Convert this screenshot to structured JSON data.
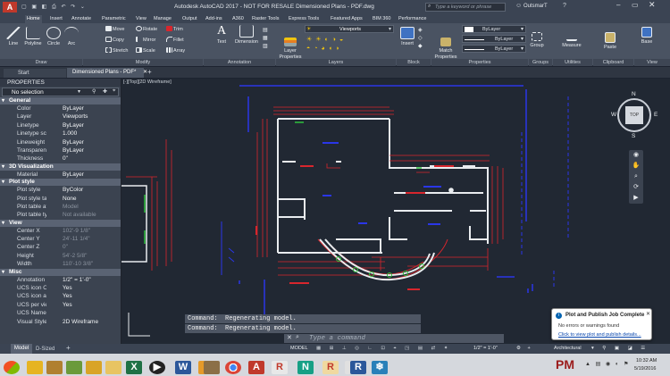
{
  "title_bar": {
    "title": "Autodesk AutoCAD 2017 - NOT FOR RESALE    Dimensioned Plans - PDF.dwg",
    "search_placeholder": "Type a keyword or phrase",
    "user": "OutsmarT"
  },
  "ribbon_tabs": [
    "Home",
    "Insert",
    "Annotate",
    "Parametric",
    "View",
    "Manage",
    "Output",
    "Add-ins",
    "A360",
    "Raster Tools",
    "Express Tools",
    "Featured Apps",
    "BIM 360",
    "Performance"
  ],
  "ribbon": {
    "draw": {
      "line": "Line",
      "polyline": "Polyline",
      "circle": "Circle",
      "arc": "Arc",
      "label": "Draw"
    },
    "modify": {
      "move": "Move",
      "rotate": "Rotate",
      "trim": "Trim",
      "copy": "Copy",
      "mirror": "Mirror",
      "fillet": "Fillet",
      "stretch": "Stretch",
      "scale": "Scale",
      "array": "Array",
      "label": "Modify"
    },
    "annotation": {
      "text": "Text",
      "dimension": "Dimension",
      "label": "Annotation"
    },
    "layers": {
      "layer_properties": "Layer Properties",
      "current_layer": "Viewports",
      "label": "Layers"
    },
    "block": {
      "insert": "Insert",
      "label": "Block"
    },
    "properties": {
      "match": "Match Properties",
      "bylayer1": "ByLayer",
      "bylayer2": "ByLayer",
      "bylayer3": "ByLayer",
      "label": "Properties"
    },
    "groups": {
      "group": "Group",
      "label": "Groups"
    },
    "utilities": {
      "measure": "Measure",
      "label": "Utilities"
    },
    "clipboard": {
      "paste": "Paste",
      "label": "Clipboard"
    },
    "view": {
      "base": "Base",
      "label": "View"
    }
  },
  "file_tabs": {
    "start": "Start",
    "current": "Dimensioned Plans - PDF*",
    "add": "+"
  },
  "properties_panel": {
    "title": "PROPERTIES",
    "selection": "No selection",
    "sections": {
      "general": {
        "label": "General",
        "rows": [
          {
            "k": "Color",
            "v": "ByLayer"
          },
          {
            "k": "Layer",
            "v": "Viewports"
          },
          {
            "k": "Linetype",
            "v": "ByLayer"
          },
          {
            "k": "Linetype scale",
            "v": "1.000"
          },
          {
            "k": "Lineweight",
            "v": "ByLayer"
          },
          {
            "k": "Transparency",
            "v": "ByLayer"
          },
          {
            "k": "Thickness",
            "v": "0\""
          }
        ]
      },
      "viz3d": {
        "label": "3D Visualization",
        "rows": [
          {
            "k": "Material",
            "v": "ByLayer"
          }
        ]
      },
      "plot": {
        "label": "Plot style",
        "rows": [
          {
            "k": "Plot style",
            "v": "ByColor"
          },
          {
            "k": "Plot style table",
            "v": "None"
          },
          {
            "k": "Plot table attach...",
            "v": "Model"
          },
          {
            "k": "Plot table type",
            "v": "Not available"
          }
        ]
      },
      "view": {
        "label": "View",
        "rows": [
          {
            "k": "Center X",
            "v": "102'-9 1/8\""
          },
          {
            "k": "Center Y",
            "v": "24'-11 1/4\""
          },
          {
            "k": "Center Z",
            "v": "0\""
          },
          {
            "k": "Height",
            "v": "54'-2 5/8\""
          },
          {
            "k": "Width",
            "v": "110'-10 3/8\""
          }
        ]
      },
      "misc": {
        "label": "Misc",
        "rows": [
          {
            "k": "Annotation scale",
            "v": "1/2\" = 1'-0\""
          },
          {
            "k": "UCS icon On",
            "v": "Yes"
          },
          {
            "k": "UCS icon at origin",
            "v": "Yes"
          },
          {
            "k": "UCS per viewport",
            "v": "Yes"
          },
          {
            "k": "UCS Name",
            "v": ""
          },
          {
            "k": "Visual Style",
            "v": "2D Wireframe"
          }
        ]
      }
    }
  },
  "viewport": {
    "label": "[-][Top][2D Wireframe]",
    "viewcube_top": "TOP",
    "compass": {
      "n": "N",
      "s": "S",
      "e": "E",
      "w": "W"
    }
  },
  "command": {
    "history1": "Command:  Regenerating model.",
    "history2": "Command:  Regenerating model.",
    "placeholder": "Type a command"
  },
  "layout_tabs": {
    "model": "Model",
    "layout": "D-Sized",
    "add": "+"
  },
  "status_bar": {
    "model": "MODEL",
    "scale": "1/2\" = 1'-0\"",
    "workspace": "Architectural"
  },
  "notification": {
    "title": "Plot and Publish Job Complete",
    "message": "No errors or warnings found",
    "link": "Click to view plot and publish details..."
  },
  "taskbar": {
    "time": "10:32 AM",
    "date": "5/19/2016"
  },
  "colors": {
    "accent": "#0063b1",
    "drawing_red": "#d8262d",
    "drawing_blue": "#2a36e8",
    "drawing_white": "#e9ecef",
    "drawing_green": "#2fbf3d"
  }
}
